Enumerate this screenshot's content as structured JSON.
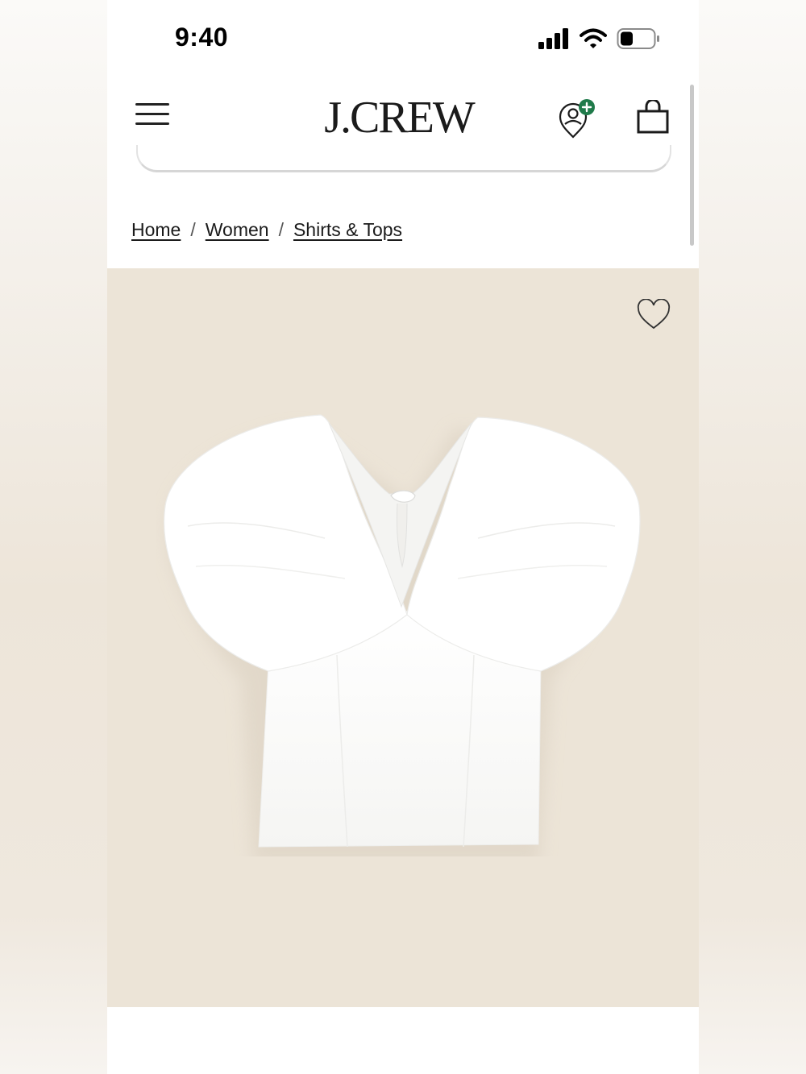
{
  "status_bar": {
    "time": "9:40",
    "icons": [
      "cellular-signal-icon",
      "wifi-icon",
      "battery-icon"
    ]
  },
  "header": {
    "logo_text": "J.CREW",
    "menu_icon": "hamburger-menu-icon",
    "account_icon": "account-add-icon",
    "bag_icon": "shopping-bag-icon"
  },
  "breadcrumb": {
    "items": [
      "Home",
      "Women",
      "Shirts & Tops"
    ],
    "separator": "/"
  },
  "product": {
    "image_subject": "white puff-sleeve cotton top",
    "wishlist_icon": "heart-icon"
  },
  "colors": {
    "image_background": "#ece4d7",
    "account_badge": "#1f7a4a",
    "text": "#1b1b1b"
  }
}
